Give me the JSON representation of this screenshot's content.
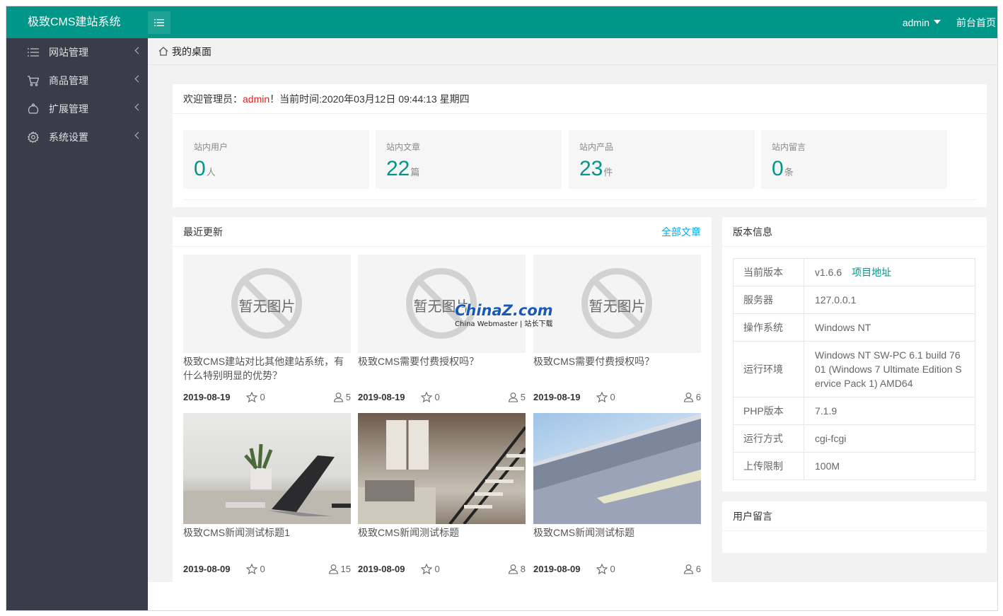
{
  "header": {
    "logo": "极致CMS建站系统",
    "user": "admin",
    "front_link": "前台首页"
  },
  "sidebar": {
    "items": [
      {
        "label": "网站管理",
        "icon": "list-icon"
      },
      {
        "label": "商品管理",
        "icon": "cart-icon"
      },
      {
        "label": "扩展管理",
        "icon": "extension-icon"
      },
      {
        "label": "系统设置",
        "icon": "gear-icon"
      }
    ]
  },
  "breadcrumb": {
    "label": "我的桌面"
  },
  "welcome": {
    "prefix": "欢迎管理员：",
    "user": "admin",
    "suffix": "！当前时间:2020年03月12日 09:44:13 星期四"
  },
  "stats": [
    {
      "label": "站内用户",
      "value": "0",
      "unit": "人"
    },
    {
      "label": "站内文章",
      "value": "22",
      "unit": "篇"
    },
    {
      "label": "站内产品",
      "value": "23",
      "unit": "件"
    },
    {
      "label": "站内留言",
      "value": "0",
      "unit": "条"
    }
  ],
  "recent": {
    "title": "最近更新",
    "more": "全部文章",
    "no_image_text": "暂无图片",
    "posts": [
      {
        "title": "极致CMS建站对比其他建站系统，有什么特别明显的优势？",
        "date": "2019-08-19",
        "likes": "0",
        "views": "5",
        "image": "none"
      },
      {
        "title": "极致CMS需要付费授权吗？",
        "date": "2019-08-19",
        "likes": "0",
        "views": "5",
        "image": "none"
      },
      {
        "title": "极致CMS需要付费授权吗？",
        "date": "2019-08-19",
        "likes": "0",
        "views": "6",
        "image": "none"
      },
      {
        "title": "极致CMS新闻测试标题1",
        "date": "2019-08-09",
        "likes": "0",
        "views": "15",
        "image": "laptop"
      },
      {
        "title": "极致CMS新闻测试标题",
        "date": "2019-08-09",
        "likes": "0",
        "views": "8",
        "image": "stairs"
      },
      {
        "title": "极致CMS新闻测试标题",
        "date": "2019-08-09",
        "likes": "0",
        "views": "6",
        "image": "building"
      }
    ]
  },
  "version": {
    "title": "版本信息",
    "rows": [
      {
        "key": "当前版本",
        "value": "v1.6.6",
        "link": "项目地址"
      },
      {
        "key": "服务器",
        "value": "127.0.0.1"
      },
      {
        "key": "操作系统",
        "value": "Windows NT"
      },
      {
        "key": "运行环境",
        "value": "Windows NT SW-PC 6.1 build 7601 (Windows 7 Ultimate Edition Service Pack 1) AMD64"
      },
      {
        "key": "PHP版本",
        "value": "7.1.9"
      },
      {
        "key": "运行方式",
        "value": "cgi-fcgi"
      },
      {
        "key": "上传限制",
        "value": "100M"
      }
    ]
  },
  "messages": {
    "title": "用户留言"
  },
  "watermark": {
    "brand": "ChinaZ.com",
    "sub": "China Webmaster | 站长下载"
  },
  "colors": {
    "header": "#009688",
    "sidebar": "#393D49",
    "accent": "#009688",
    "link": "#01AAED",
    "highlight": "#e02020"
  }
}
